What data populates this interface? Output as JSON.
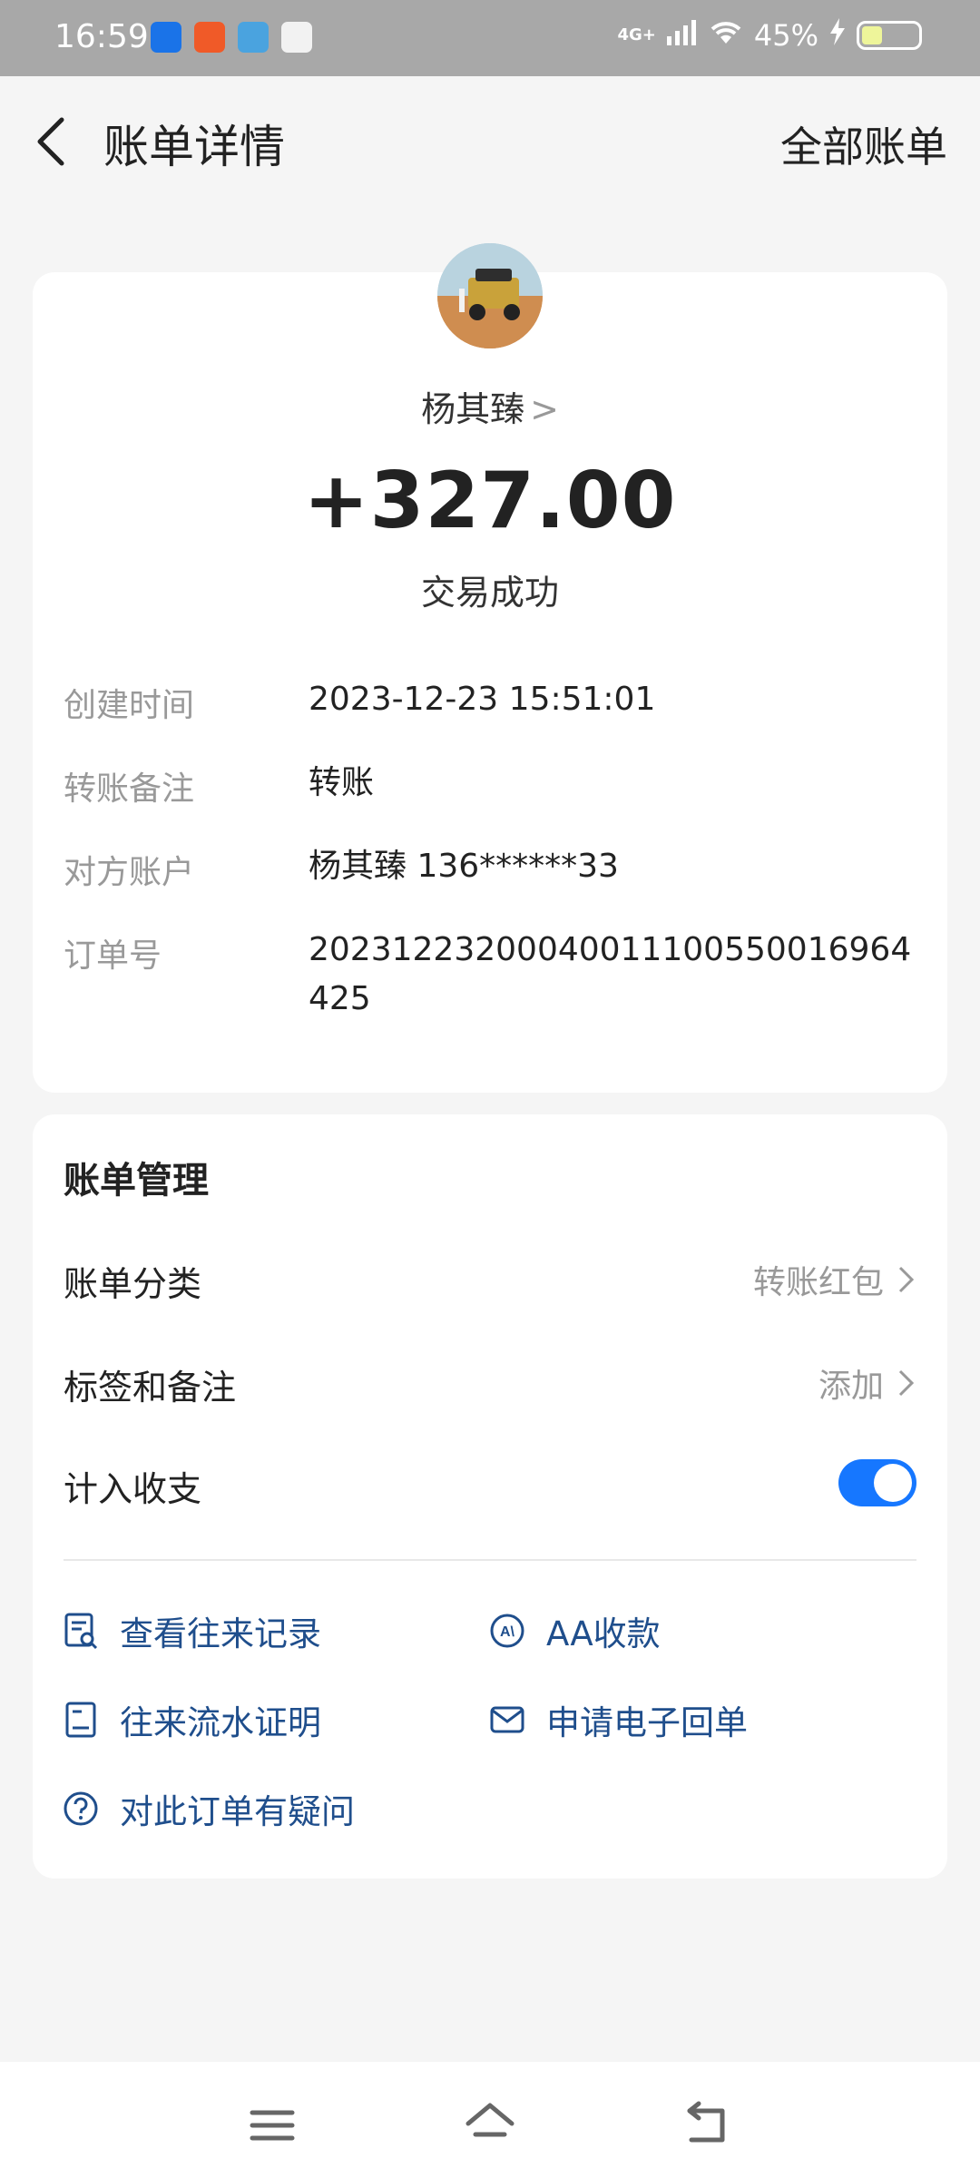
{
  "status_bar": {
    "time": "16:59",
    "network": "4G+",
    "battery": "45%"
  },
  "header": {
    "title": "账单详情",
    "right_link": "全部账单"
  },
  "transaction": {
    "counterparty": "杨其臻",
    "amount": "+327.00",
    "status": "交易成功"
  },
  "details": [
    {
      "label": "创建时间",
      "value": "2023-12-23 15:51:01"
    },
    {
      "label": "转账备注",
      "value": "转账"
    },
    {
      "label": "对方账户",
      "value": "杨其臻 136******33"
    },
    {
      "label": "订单号",
      "value": "20231223200040011100550016964425"
    }
  ],
  "management": {
    "title": "账单管理",
    "category_label": "账单分类",
    "category_value": "转账红包",
    "tag_label": "标签和备注",
    "tag_value": "添加",
    "count_label": "计入收支",
    "count_enabled": true
  },
  "actions": {
    "records": "查看往来记录",
    "aa": "AA收款",
    "proof": "往来流水证明",
    "receipt": "申请电子回单",
    "question": "对此订单有疑问"
  },
  "colors": {
    "accent": "#1677ff",
    "link": "#1f4e8c"
  }
}
